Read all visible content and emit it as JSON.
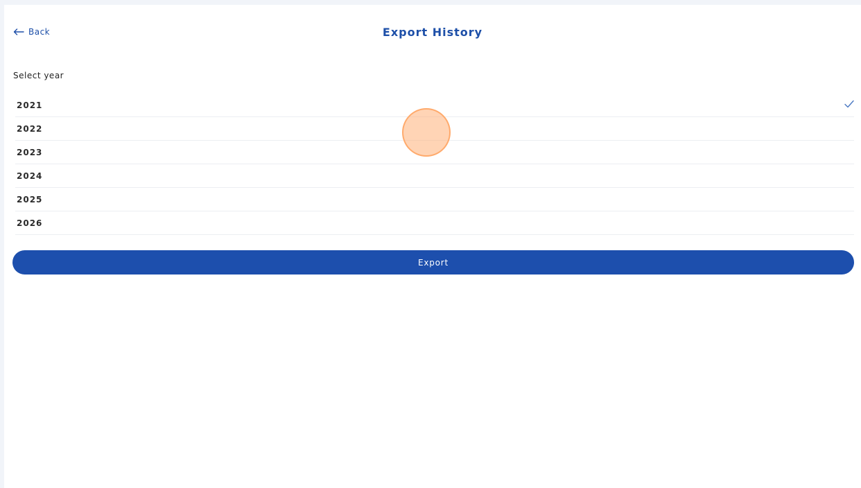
{
  "header": {
    "back_label": "Back",
    "title": "Export History"
  },
  "year_picker": {
    "label": "Select year",
    "selected": "2021",
    "years": [
      "2021",
      "2022",
      "2023",
      "2024",
      "2025",
      "2026"
    ]
  },
  "actions": {
    "export_label": "Export"
  },
  "colors": {
    "accent": "#1d4fad",
    "check": "#4a78c2",
    "touch_indicator": "#ffb078"
  },
  "icons": {
    "back": "arrow-left-icon",
    "selected": "check-icon"
  }
}
